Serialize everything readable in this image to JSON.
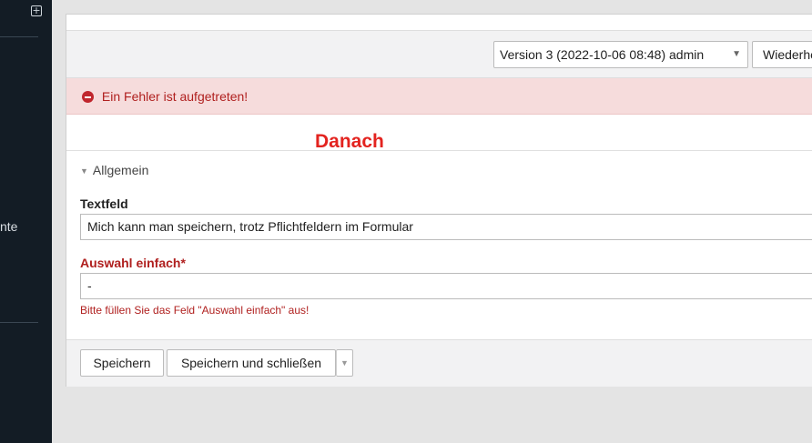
{
  "sidebar": {
    "add_icon": "plus-square-icon",
    "truncated_label": "nte"
  },
  "toolbar": {
    "version_select": "Version 3 (2022-10-06 08:48) admin",
    "restore_button": "Wiederherstellen"
  },
  "alert": {
    "icon": "minus-circle-icon",
    "message": "Ein Fehler ist aufgetreten!",
    "color": "#b0201f"
  },
  "annotation": {
    "heading": "Danach",
    "color": "#e3231f"
  },
  "section": {
    "label": "Allgemein"
  },
  "fields": {
    "textfeld": {
      "label": "Textfeld",
      "value": "Mich kann man speichern, trotz Pflichtfeldern im Formular"
    },
    "auswahl": {
      "label": "Auswahl einfach*",
      "value": "-",
      "error": "Bitte füllen Sie das Feld \"Auswahl einfach\" aus!"
    }
  },
  "footer": {
    "save_label": "Speichern",
    "save_close_label": "Speichern und schließen",
    "split_caret": "▼"
  }
}
